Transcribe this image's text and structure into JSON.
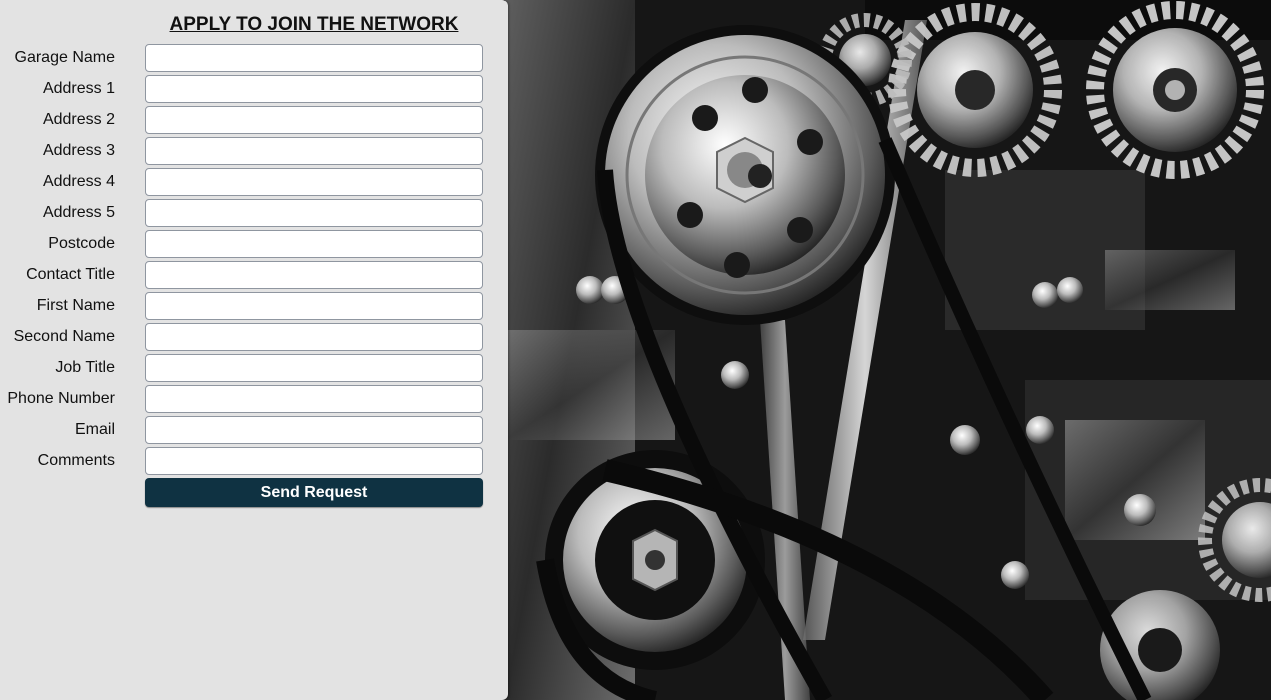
{
  "form": {
    "title": "APPLY TO JOIN THE NETWORK",
    "fields": [
      {
        "label": "Garage Name",
        "value": "",
        "placeholder": ""
      },
      {
        "label": "Address 1",
        "value": "",
        "placeholder": ""
      },
      {
        "label": "Address 2",
        "value": "",
        "placeholder": ""
      },
      {
        "label": "Address 3",
        "value": "",
        "placeholder": ""
      },
      {
        "label": "Address 4",
        "value": "",
        "placeholder": ""
      },
      {
        "label": "Address 5",
        "value": "",
        "placeholder": ""
      },
      {
        "label": "Postcode",
        "value": "",
        "placeholder": ""
      },
      {
        "label": "Contact Title",
        "value": "",
        "placeholder": ""
      },
      {
        "label": "First Name",
        "value": "",
        "placeholder": ""
      },
      {
        "label": "Second Name",
        "value": "",
        "placeholder": ""
      },
      {
        "label": "Job Title",
        "value": "",
        "placeholder": ""
      },
      {
        "label": "Phone Number",
        "value": "",
        "placeholder": ""
      },
      {
        "label": "Email",
        "value": "",
        "placeholder": ""
      },
      {
        "label": "Comments",
        "value": "",
        "placeholder": ""
      }
    ],
    "submit_label": "Send Request"
  },
  "colors": {
    "panel_background": "#e3e3e3",
    "button_background": "#0f3242",
    "button_text": "#ffffff"
  },
  "background_image": {
    "subject": "car-engine-pulleys-photo"
  }
}
